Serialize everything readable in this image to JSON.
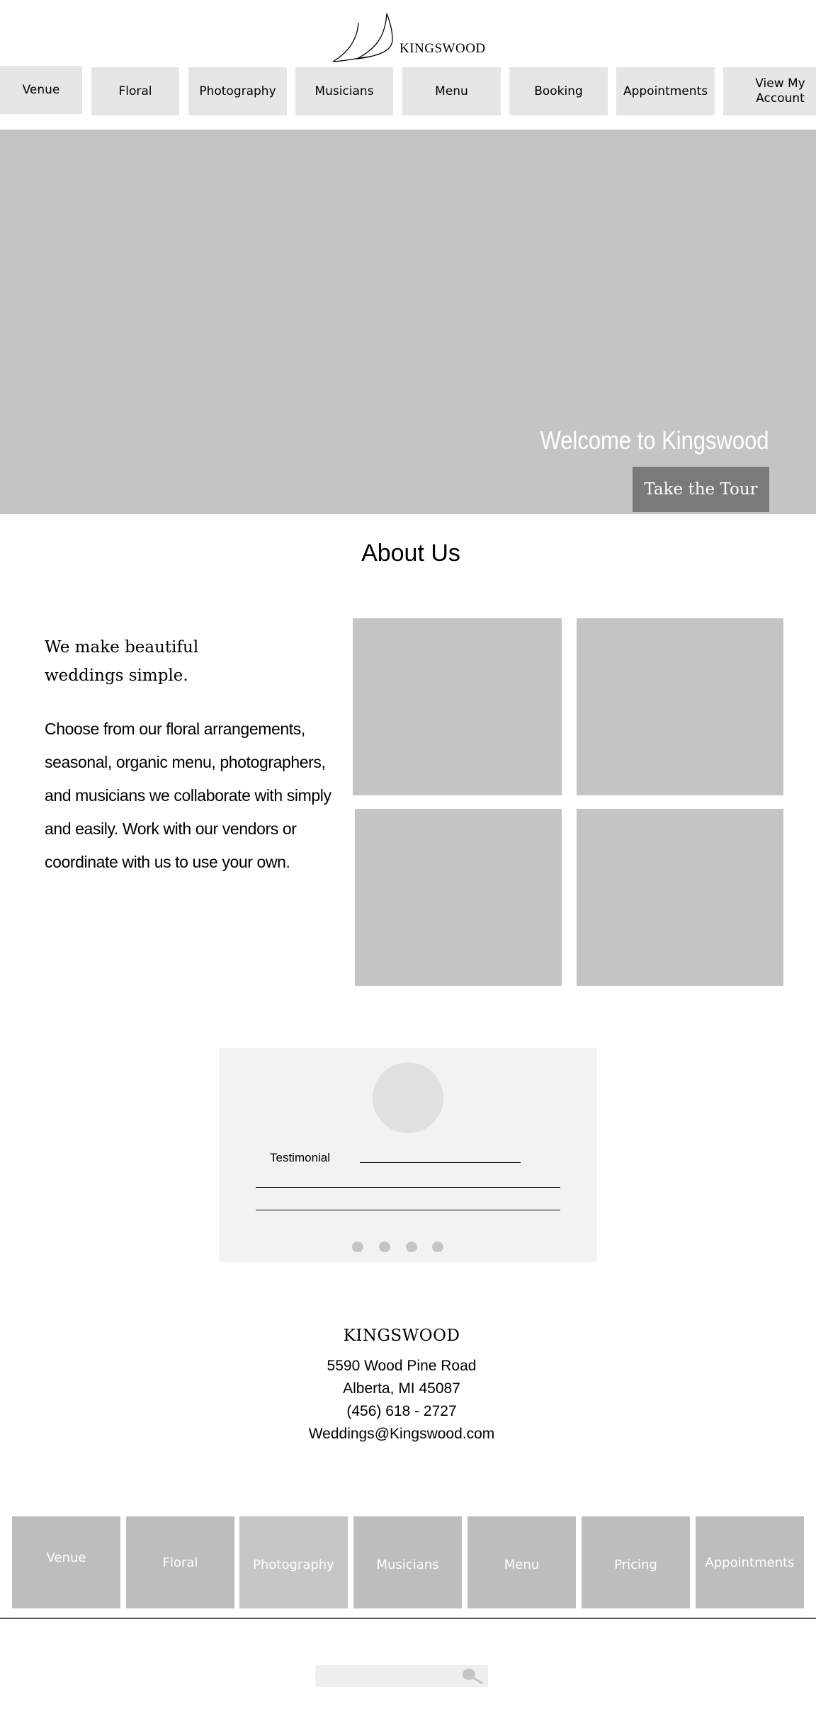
{
  "header": {
    "logo_icon": "leaf-logo-icon",
    "brand": "KINGSWOOD",
    "nav": [
      {
        "label": "Venue"
      },
      {
        "label": "Floral"
      },
      {
        "label": "Photography"
      },
      {
        "label": "Musicians"
      },
      {
        "label": "Menu"
      },
      {
        "label": "Booking"
      },
      {
        "label": "Appointments"
      },
      {
        "label": "View My\nAccount"
      }
    ]
  },
  "hero": {
    "title": "Welcome to Kingswood",
    "cta_label": "Take the Tour"
  },
  "about": {
    "title": "About Us",
    "heading": "We make beautiful weddings simple.",
    "body": "Choose from our floral arrangements, seasonal, organic menu, photographers, and musicians we collaborate with simply and easily. Work with our vendors or coordinate with us to use your own."
  },
  "testimonial": {
    "label": "Testimonial",
    "dot_count": 4
  },
  "contact": {
    "brand": "KINGSWOOD",
    "address_line1": "5590 Wood Pine Road",
    "address_line2": "Alberta, MI 45087",
    "phone": "(456) 618 - 2727",
    "email": "Weddings@Kingswood.com"
  },
  "footer": {
    "nav": [
      {
        "label": "Venue"
      },
      {
        "label": "Floral"
      },
      {
        "label": "Photography"
      },
      {
        "label": "Musicians"
      },
      {
        "label": "Menu"
      },
      {
        "label": "Pricing"
      },
      {
        "label": "Appointments"
      }
    ],
    "search_icon": "search-icon"
  },
  "colors": {
    "placeholder_gray": "#c4c4c4",
    "nav_bg": "#e6e6e6",
    "cta_bg": "#7a7a7a",
    "card_bg": "#f2f2f2"
  }
}
